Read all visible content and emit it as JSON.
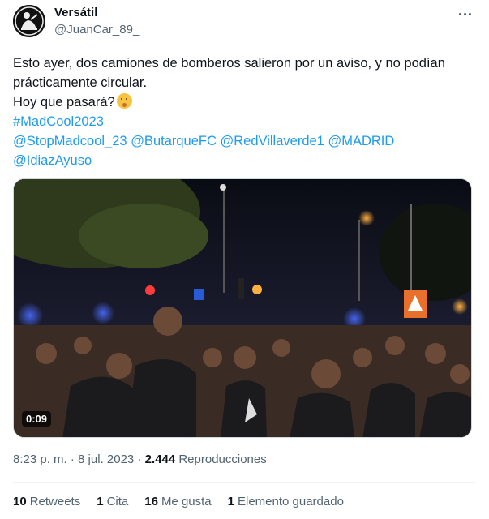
{
  "user": {
    "name": "Versátil",
    "handle": "@JuanCar_89_"
  },
  "tweet": {
    "line1": "Esto ayer, dos camiones de bomberos salieron por un aviso, y no podían",
    "line2": "prácticamente circular.",
    "line3": "Hoy que pasará?",
    "emoji": "shushing-face",
    "hashtag": "#MadCool2023",
    "mentions": [
      "@StopMadcool_23",
      "@ButarqueFC",
      "@RedVillaverde1",
      "@MADRID",
      "@IdiazAyuso"
    ]
  },
  "video": {
    "duration": "0:09"
  },
  "meta": {
    "time": "8:23 p. m.",
    "separator": "·",
    "date": "8 jul. 2023",
    "views": "2.444",
    "views_label": "Reproducciones"
  },
  "stats": [
    {
      "count": "10",
      "label": "Retweets"
    },
    {
      "count": "1",
      "label": "Cita"
    },
    {
      "count": "16",
      "label": "Me gusta"
    },
    {
      "count": "1",
      "label": "Elemento guardado"
    }
  ],
  "colors": {
    "accent": "#1d9bf0",
    "text": "#0f1419",
    "muted": "#536471",
    "border": "#eff3f4"
  }
}
